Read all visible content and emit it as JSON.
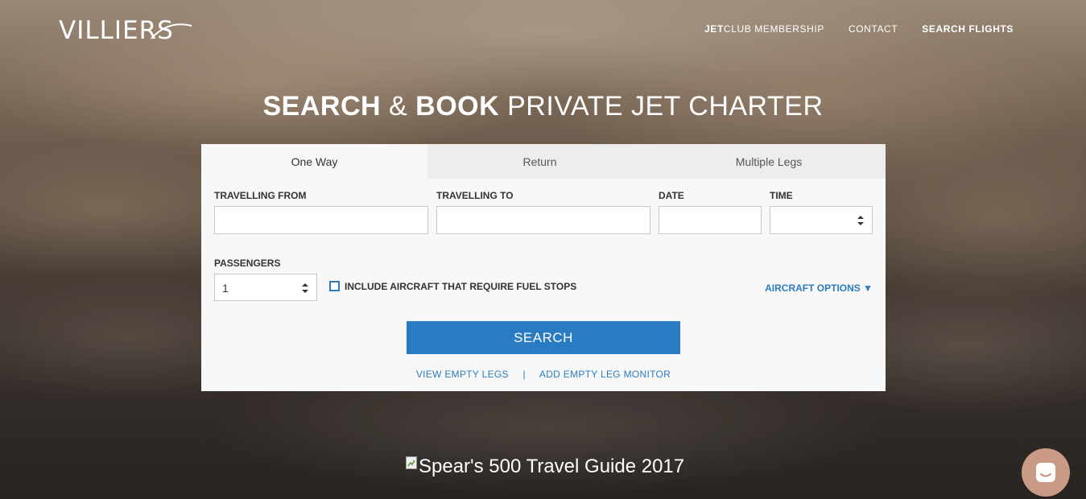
{
  "brand": {
    "logo_text": "VILLIERS"
  },
  "nav": {
    "jetclub_bold": "JET",
    "jetclub_rest": "CLUB MEMBERSHIP",
    "contact": "CONTACT",
    "search_flights": "SEARCH FLIGHTS"
  },
  "hero": {
    "word1": "SEARCH",
    "amp": "&",
    "word2": "BOOK",
    "rest": "PRIVATE JET CHARTER"
  },
  "tabs": [
    "One Way",
    "Return",
    "Multiple Legs"
  ],
  "form": {
    "from_label": "TRAVELLING FROM",
    "to_label": "TRAVELLING TO",
    "date_label": "DATE",
    "time_label": "TIME",
    "passengers_label": "PASSENGERS",
    "passengers_value": "1",
    "fuel_stops_label": "INCLUDE AIRCRAFT THAT REQUIRE FUEL STOPS",
    "aircraft_options": "AIRCRAFT OPTIONS ▼",
    "search_button": "SEARCH"
  },
  "links": {
    "empty_legs": "VIEW EMPTY LEGS",
    "separator": "|",
    "monitor": "ADD EMPTY LEG MONITOR"
  },
  "badge": {
    "alt_text": "Spear's 500 Travel Guide 2017"
  },
  "colors": {
    "accent": "#2a7cc2",
    "chat": "#c99a86"
  }
}
